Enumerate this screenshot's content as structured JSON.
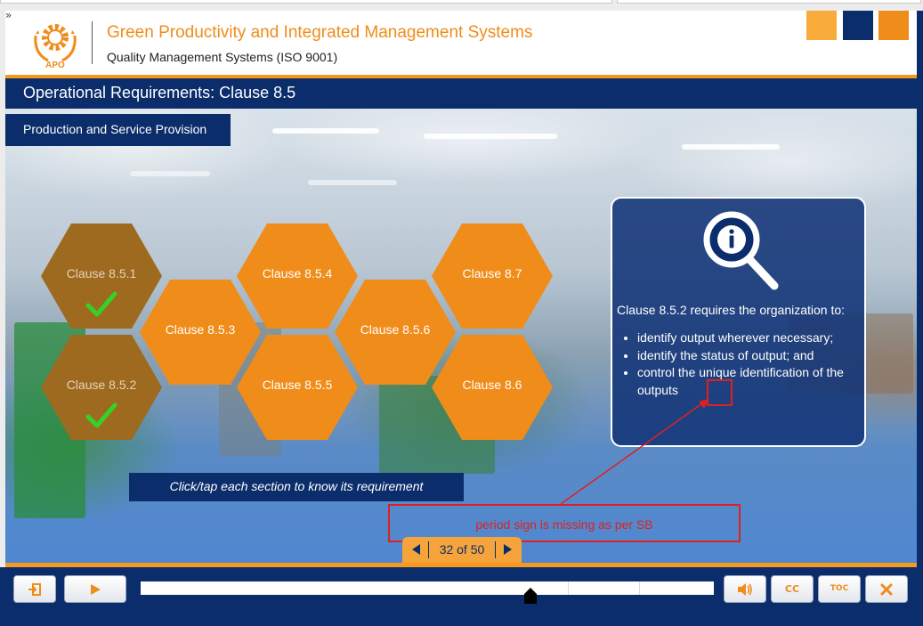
{
  "header": {
    "title": "Green Productivity and Integrated Management Systems",
    "subtitle": "Quality Management Systems (ISO 9001)",
    "logo_text": "APO",
    "expand_glyph": "»",
    "colors": {
      "accent": "#f08c1a",
      "navy": "#0b2d6b",
      "light_orange": "#f8ab3a"
    }
  },
  "page": {
    "title": "Operational Requirements: Clause 8.5",
    "section": "Production and Service Provision"
  },
  "hexagons": [
    {
      "label": "Clause 8.5.1",
      "visited": true
    },
    {
      "label": "Clause 8.5.2",
      "visited": true
    },
    {
      "label": "Clause 8.5.3",
      "visited": false
    },
    {
      "label": "Clause 8.5.4",
      "visited": false
    },
    {
      "label": "Clause 8.5.5",
      "visited": false
    },
    {
      "label": "Clause 8.5.6",
      "visited": false
    },
    {
      "label": "Clause 8.7",
      "visited": false
    },
    {
      "label": "Clause 8.6",
      "visited": false
    }
  ],
  "info_panel": {
    "icon": "magnifier-info-icon",
    "intro": "Clause 8.5.2 requires the organization to:",
    "bullets": [
      "identify output wherever necessary;",
      "identify the status of output; and",
      "control the unique identification of the outputs"
    ]
  },
  "instruction": "Click/tap each section to know its requirement",
  "review_note": "period sign is missing as per SB",
  "pager": {
    "text": "32 of 50",
    "current": 32,
    "total": 50
  },
  "controls": {
    "exit_icon": "exit-icon",
    "play_icon": "play-icon",
    "volume_icon": "volume-icon",
    "cc_label": "CC",
    "toc_label": "TOC",
    "close_icon": "close-icon",
    "progress_fraction": 0.68
  }
}
